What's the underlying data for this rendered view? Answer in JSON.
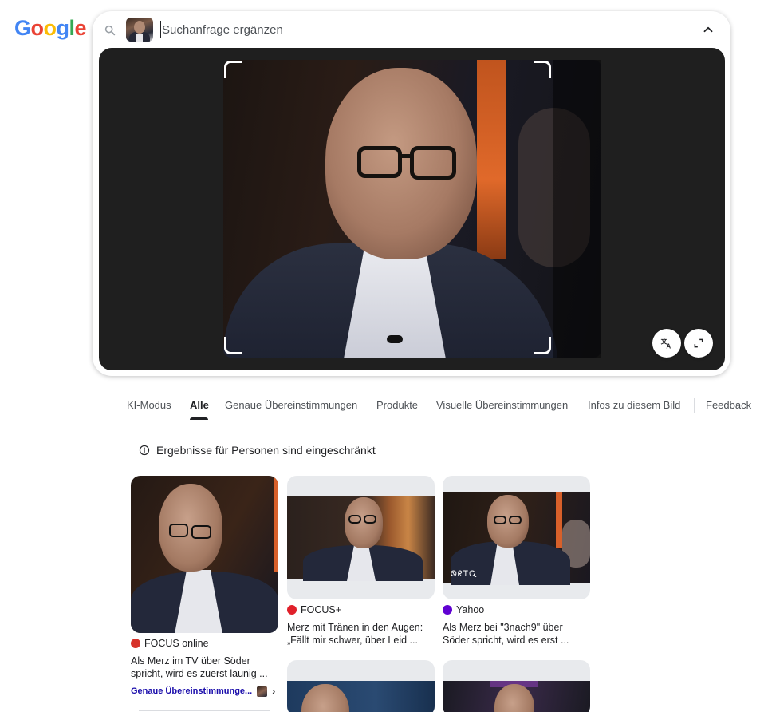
{
  "logo": {
    "letters": [
      "G",
      "o",
      "o",
      "g",
      "l",
      "e"
    ],
    "colors": [
      "#4285F4",
      "#EA4335",
      "#FBBC05",
      "#4285F4",
      "#34A853",
      "#EA4335"
    ]
  },
  "search": {
    "placeholder": "Suchanfrage ergänzen",
    "value": ""
  },
  "viewer": {
    "translate_icon": "translate-icon",
    "expand_icon": "expand-icon"
  },
  "tabs": [
    {
      "label": "KI-Modus",
      "active": false
    },
    {
      "label": "Alle",
      "active": true
    },
    {
      "label": "Genaue Übereinstimmungen",
      "active": false
    },
    {
      "label": "Produkte",
      "active": false
    },
    {
      "label": "Visuelle Übereinstimmungen",
      "active": false
    },
    {
      "label": "Infos zu diesem Bild",
      "active": false
    },
    {
      "label": "Feedback",
      "active": false
    }
  ],
  "notice": {
    "text": "Ergebnisse für Personen sind eingeschränkt"
  },
  "results": [
    {
      "source": "FOCUS online",
      "source_color": "#d6322a",
      "title": "Als Merz im TV über Söder spricht, wird es zuerst launig ...",
      "link": "Genaue Übereinstimmunge..."
    },
    {
      "source": "FOCUS+",
      "source_color": "#e0202a",
      "title": "Merz mit Tränen in den Augen: „Fällt mir schwer, über Leid ..."
    },
    {
      "source": "Yahoo",
      "source_color": "#6001d2",
      "title": "Als Merz bei \"3nach9\" über Söder spricht, wird es erst ...",
      "watermark": "ᏫᖇᏆᏩ"
    }
  ]
}
